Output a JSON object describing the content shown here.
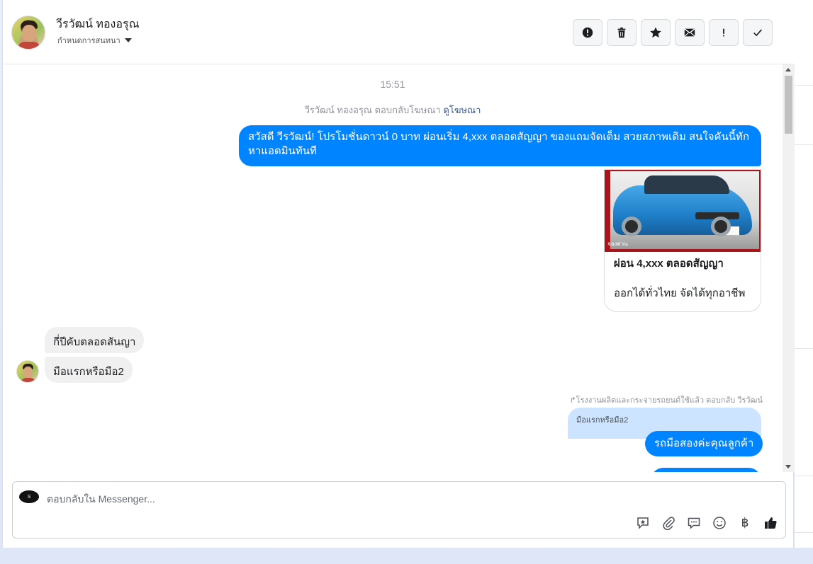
{
  "header": {
    "name": "วีรวัฒน์ ทองอรุณ",
    "subtitle": "กำหนดการสนทนา",
    "actions": [
      "spam-icon",
      "trash-icon",
      "star-icon",
      "mail-icon",
      "important-icon",
      "check-icon"
    ]
  },
  "chat": {
    "timestamp": "15:51",
    "ad_reply_text": "วีรวัฒน์ ทองอรุณ ตอบกลับโฆษณา",
    "ad_reply_link": "ดูโฆษณา",
    "outgoing_promo": "สวัสดี วีรวัฒน์! โปรโมชั่นดาวน์ 0 บาท ผ่อนเริ่ม 4,xxx ตลอดสัญญา ของแถมจัดเต็ม สวยสภาพเดิม สนใจคันนี้ทักหาแอดมินทันที",
    "card": {
      "image_caption": "จองด่วน",
      "title": "ผ่อน 4,xxx ตลอดสัญญา",
      "description": "ออกได้ทั่วไทย จัดได้ทุกอาชีพ"
    },
    "incoming": [
      "กี่ปีคับตลอดสันญา",
      "มือแรกหรือมือ2"
    ],
    "reply_info": "โรงงานผลิตและกระจายรถยนต์ใช้แล้ว ตอบกลับ วีรวัฒน์",
    "quoted": "มือแรกหรือมือ2",
    "outgoing_reply": "รถมือสองค่ะคุณลูกค้า"
  },
  "composer": {
    "placeholder": "ตอบกลับใน Messenger...",
    "tools": [
      "saved-reply-icon",
      "attachment-icon",
      "chat-icon",
      "emoji-icon",
      "baht-icon",
      "like-icon"
    ],
    "baht_symbol": "฿"
  },
  "colors": {
    "accent": "#0084ff",
    "incoming_bubble": "#f1f0f0",
    "quoted_bubble": "#cce4ff",
    "link": "#385898"
  }
}
